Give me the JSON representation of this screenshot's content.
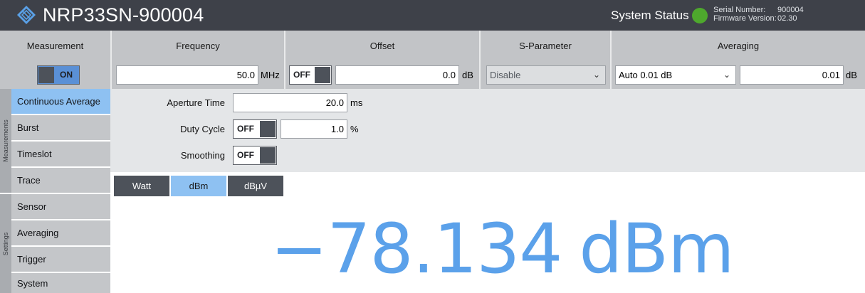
{
  "device": {
    "name": "NRP33SN-900004"
  },
  "status": {
    "label": "System Status",
    "indicator_color": "#4ea82d",
    "serial_label": "Serial Number:",
    "serial_value": "900004",
    "firmware_label": "Firmware Version:",
    "firmware_value": "02.30"
  },
  "header": {
    "measurement": "Measurement",
    "frequency": "Frequency",
    "offset": "Offset",
    "sparameter": "S-Parameter",
    "averaging": "Averaging"
  },
  "controls": {
    "measurement_toggle": "ON",
    "frequency_value": "50.0",
    "frequency_unit": "MHz",
    "offset_toggle": "OFF",
    "offset_value": "0.0",
    "offset_unit": "dB",
    "sparameter_selected": "Disable",
    "averaging_selected": "Auto 0.01 dB",
    "averaging_value": "0.01",
    "averaging_unit": "dB"
  },
  "sidebar": {
    "measurements_tab": "Measurements",
    "settings_tab": "Settings",
    "items": [
      {
        "label": "Continuous Average",
        "active": true
      },
      {
        "label": "Burst",
        "active": false
      },
      {
        "label": "Timeslot",
        "active": false
      },
      {
        "label": "Trace",
        "active": false
      },
      {
        "label": "Sensor",
        "active": false
      },
      {
        "label": "Averaging",
        "active": false
      },
      {
        "label": "Trigger",
        "active": false
      },
      {
        "label": "System",
        "active": false
      }
    ]
  },
  "settings": {
    "aperture_label": "Aperture Time",
    "aperture_value": "20.0",
    "aperture_unit": "ms",
    "duty_label": "Duty Cycle",
    "duty_toggle": "OFF",
    "duty_value": "1.0",
    "duty_unit": "%",
    "smoothing_label": "Smoothing",
    "smoothing_toggle": "OFF"
  },
  "units": {
    "options": [
      "Watt",
      "dBm",
      "dBµV"
    ],
    "selected": "dBm"
  },
  "reading": {
    "value": "−78.134",
    "unit": "dBm",
    "color": "#5ba1ea"
  }
}
